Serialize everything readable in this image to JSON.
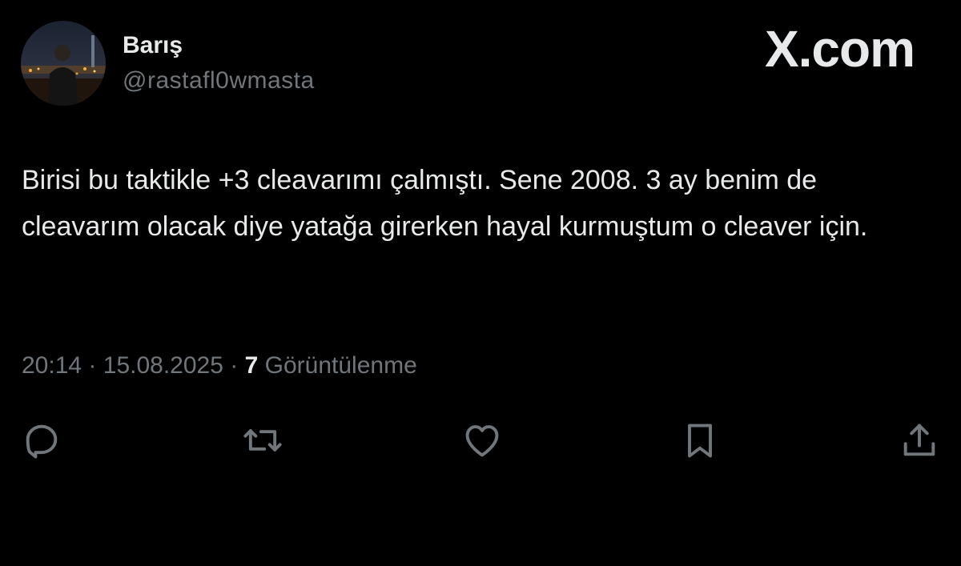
{
  "author": {
    "display_name": "Barış",
    "handle": "@rastafl0wmasta"
  },
  "brand": "X.com",
  "tweet": {
    "text": "Birisi bu taktikle +3 cleavarımı çalmıştı. Sene 2008. 3 ay benim de cleavarım olacak diye yatağa girerken hayal kurmuştum o cleaver için.",
    "time": "20:14",
    "date": "15.08.2025",
    "separator": "·",
    "views_count": "7",
    "views_label": "Görüntülenme"
  },
  "actions": [
    {
      "name": "reply",
      "icon": "reply-icon"
    },
    {
      "name": "repost",
      "icon": "repost-icon"
    },
    {
      "name": "like",
      "icon": "heart-icon"
    },
    {
      "name": "bookmark",
      "icon": "bookmark-icon"
    },
    {
      "name": "share",
      "icon": "share-icon"
    }
  ],
  "colors": {
    "background": "#000000",
    "text_primary": "#e7e9ea",
    "text_secondary": "#71767b"
  }
}
